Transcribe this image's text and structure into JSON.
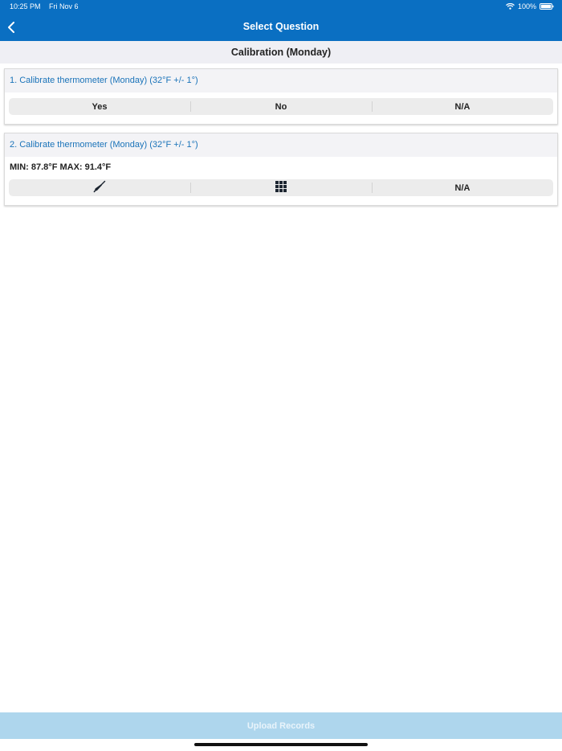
{
  "status_bar": {
    "time": "10:25 PM",
    "date": "Fri Nov 6",
    "battery": "100%",
    "icons": [
      "wifi-icon",
      "battery-icon"
    ]
  },
  "nav": {
    "title": "Select Question",
    "back_icon": "chevron-left-icon"
  },
  "section": {
    "title": "Calibration (Monday)"
  },
  "questions": [
    {
      "title": "1. Calibrate thermometer (Monday) (32°F +/- 1°)",
      "options": [
        "Yes",
        "No",
        "N/A"
      ]
    },
    {
      "title": "2. Calibrate thermometer (Monday) (32°F +/- 1°)",
      "reading": "MIN: 87.8°F MAX: 91.4°F",
      "options": [
        {
          "icon": "thermometer-probe-icon"
        },
        {
          "icon": "keypad-grid-icon"
        },
        {
          "label": "N/A"
        }
      ]
    }
  ],
  "footer": {
    "upload_label": "Upload Records"
  },
  "colors": {
    "primary": "#0a6fc2",
    "question_title": "#1a73b9",
    "upload_disabled": "#aed6ed",
    "segment_bg": "#ececec"
  }
}
